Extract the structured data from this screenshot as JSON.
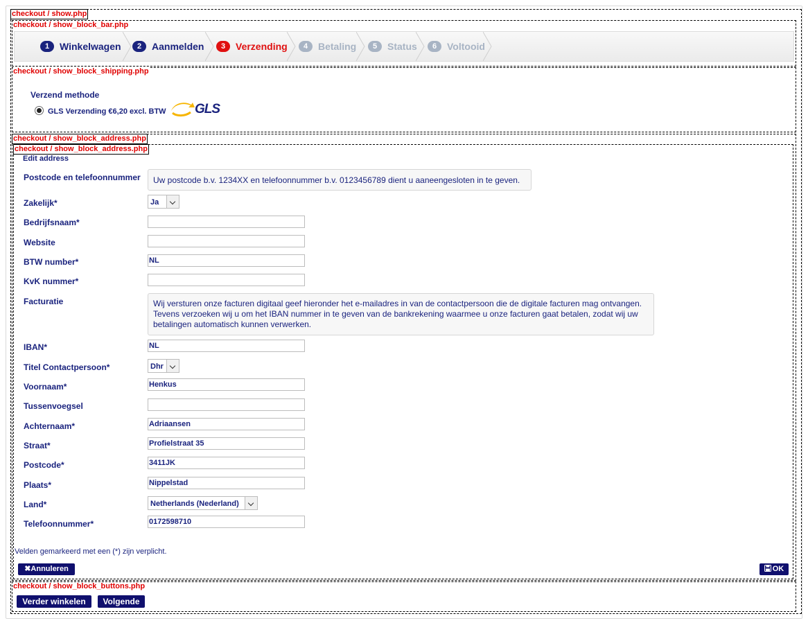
{
  "tags": {
    "show": "checkout / show.php",
    "bar": "checkout / show_block_bar.php",
    "shipping": "checkout / show_block_shipping.php",
    "address1": "checkout / show_block_address.php",
    "address2": "checkout / show_block_address.php",
    "buttons": "checkout / show_block_buttons.php"
  },
  "steps": [
    {
      "num": "1",
      "label": "Winkelwagen",
      "state": "done"
    },
    {
      "num": "2",
      "label": "Aanmelden",
      "state": "done"
    },
    {
      "num": "3",
      "label": "Verzending",
      "state": "active"
    },
    {
      "num": "4",
      "label": "Betaling",
      "state": "todo"
    },
    {
      "num": "5",
      "label": "Status",
      "state": "todo"
    },
    {
      "num": "6",
      "label": "Voltooid",
      "state": "todo"
    }
  ],
  "shipping": {
    "heading": "Verzend methode",
    "option_label": "GLS Verzending €6,20 excl. BTW",
    "logo_text": "GLS"
  },
  "address": {
    "heading": "Edit address",
    "postcode_label": "Postcode en telefoonnummer",
    "postcode_info": "Uw postcode b.v. 1234XX en telefoonnummer b.v. 0123456789 dient u aaneengesloten in te geven.",
    "zakelijk_label": "Zakelijk*",
    "zakelijk_value": "Ja",
    "bedrijfsnaam_label": "Bedrijfsnaam*",
    "bedrijfsnaam_value": "",
    "website_label": "Website",
    "website_value": "",
    "btw_label": "BTW number*",
    "btw_value": "NL",
    "kvk_label": "KvK nummer*",
    "kvk_value": "",
    "facturatie_label": "Facturatie",
    "facturatie_info": "Wij versturen onze facturen digitaal geef hieronder het e-mailadres in van de contactpersoon die de digitale facturen mag ontvangen. Tevens verzoeken wij u om het IBAN nummer in te geven van de bankrekening waarmee u onze facturen gaat betalen, zodat wij uw betalingen automatisch kunnen verwerken.",
    "iban_label": "IBAN*",
    "iban_value": "NL",
    "titel_label": "Titel Contactpersoon*",
    "titel_value": "Dhr",
    "voornaam_label": "Voornaam*",
    "voornaam_value": "Henkus",
    "tussen_label": "Tussenvoegsel",
    "tussen_value": "",
    "achternaam_label": "Achternaam*",
    "achternaam_value": "Adriaansen",
    "straat_label": "Straat*",
    "straat_value": "Profielstraat 35",
    "postcode2_label": "Postcode*",
    "postcode2_value": "3411JK",
    "plaats_label": "Plaats*",
    "plaats_value": "Nippelstad",
    "land_label": "Land*",
    "land_value": "Netherlands (Nederland)",
    "telefoon_label": "Telefoonnummer*",
    "telefoon_value": "0172598710",
    "required_note": "Velden gemarkeerd met een (*) zijn verplicht.",
    "cancel_label": "Annuleren",
    "ok_label": "OK"
  },
  "buttons": {
    "continue_shopping": "Verder winkelen",
    "next": "Volgende"
  },
  "colors": {
    "primary": "#10106e",
    "text": "#1a237e",
    "active": "#e01010",
    "todo": "#a8b4c4",
    "tag": "#e00000"
  }
}
